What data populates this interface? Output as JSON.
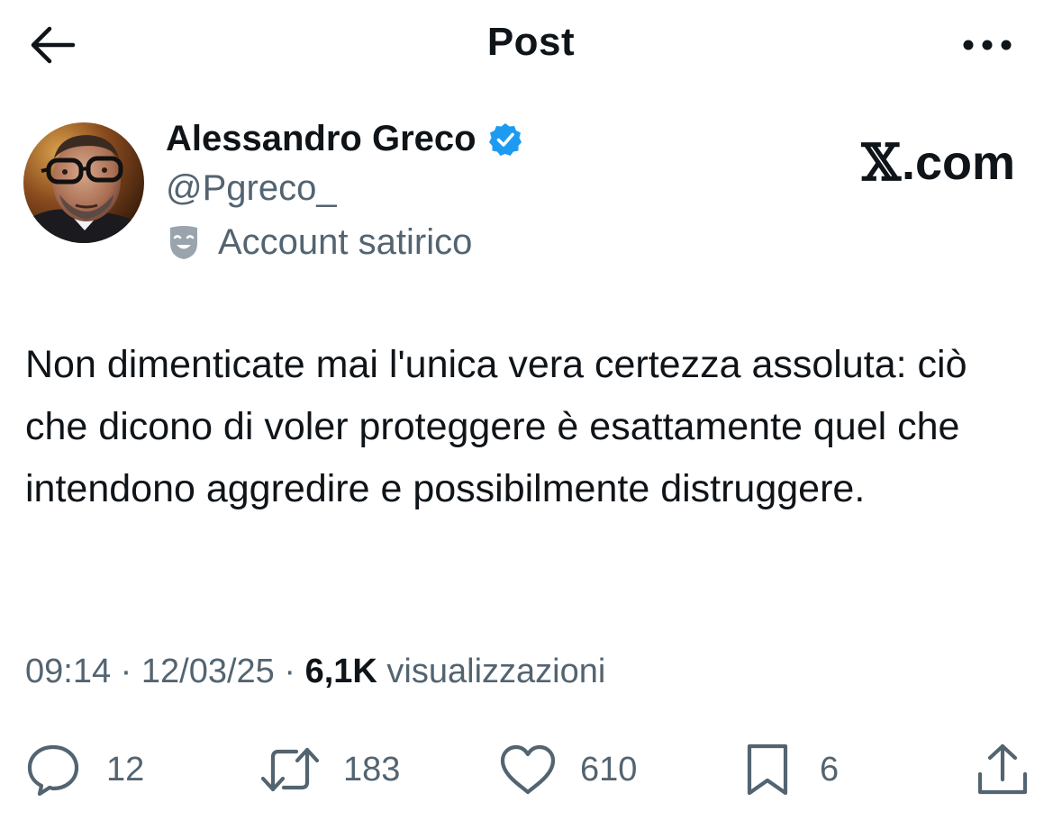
{
  "header": {
    "title": "Post",
    "back_icon": "arrow-left-icon",
    "more_icon": "more-horizontal-icon"
  },
  "author": {
    "name": "Alessandro Greco",
    "handle": "@Pgreco_",
    "verified": true,
    "verified_color": "#1d9bf0",
    "label": "Account satirico",
    "label_icon": "theater-mask-icon"
  },
  "watermark": {
    "x": "𝕏",
    "domain": ".com"
  },
  "post": {
    "text": "Non dimenticate mai l'unica vera certezza assoluta: ciò che dicono di voler proteggere è esattamente quel che intendono aggredire e possibilmente distruggere."
  },
  "meta": {
    "time": "09:14",
    "sep1": " · ",
    "date": "12/03/25",
    "sep2": " · ",
    "views": "6,1K",
    "views_label": " visualizzazioni"
  },
  "actions": {
    "replies": "12",
    "reposts": "183",
    "likes": "610",
    "bookmarks": "6"
  },
  "colors": {
    "text_primary": "#0f1419",
    "text_secondary": "#536471",
    "accent": "#1d9bf0",
    "background": "#ffffff"
  }
}
